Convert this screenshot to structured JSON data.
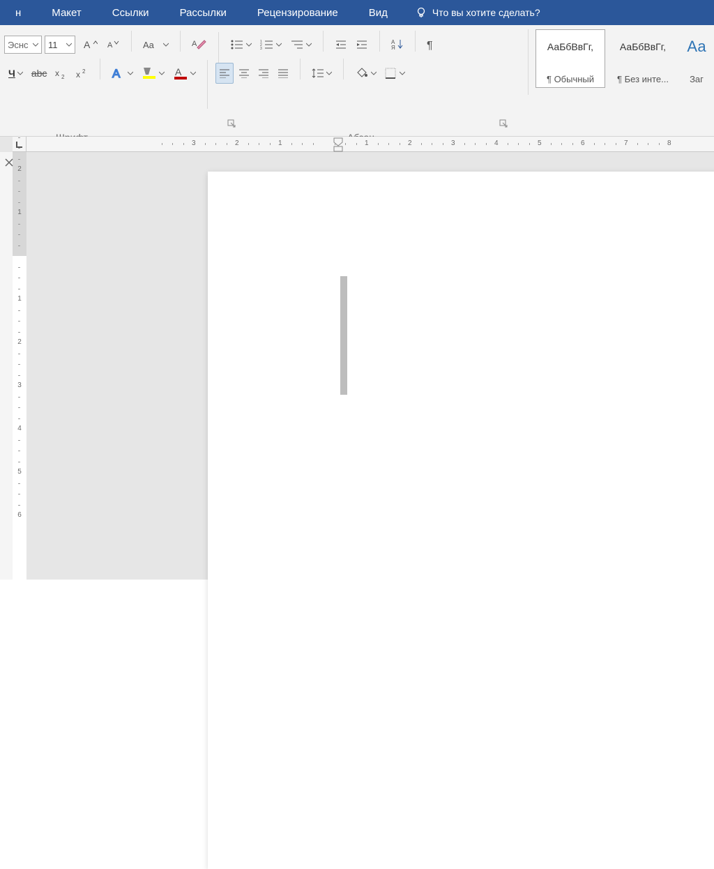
{
  "menu": {
    "items": [
      "н",
      "Макет",
      "Ссылки",
      "Рассылки",
      "Рецензирование",
      "Вид"
    ],
    "tell_me": "Что вы хотите сделать?"
  },
  "ribbon": {
    "font_name_fragment": "Эснс",
    "font_size": "11",
    "groups": {
      "font": "Шрифт",
      "paragraph": "Абзац"
    }
  },
  "styles": [
    {
      "preview": "АаБбВвГг,",
      "name": "¶ Обычный",
      "selected": true,
      "color": "#333"
    },
    {
      "preview": "АаБбВвГг,",
      "name": "¶ Без инте...",
      "selected": false,
      "color": "#333"
    },
    {
      "preview": "Аа",
      "name": "Заг",
      "selected": false,
      "color": "#2E74B5"
    }
  ],
  "hruler": [
    "3",
    "2",
    "1",
    "",
    "1",
    "2",
    "3",
    "4",
    "5",
    "6",
    "7",
    "8"
  ],
  "vruler": [
    "2",
    "1",
    "",
    "1",
    "2",
    "3",
    "4",
    "5",
    "6"
  ],
  "colors": {
    "ribbon_blue": "#2b579a",
    "highlight_yellow": "#FFFF00",
    "font_red": "#C00000"
  }
}
